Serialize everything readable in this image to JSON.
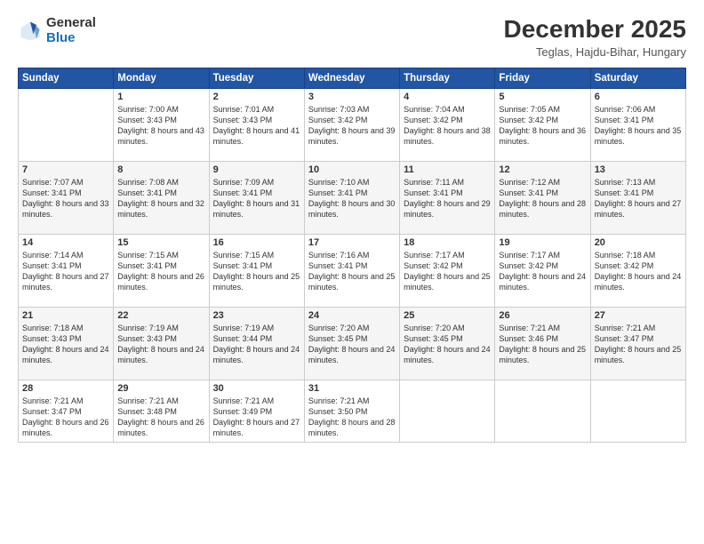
{
  "header": {
    "logo_general": "General",
    "logo_blue": "Blue",
    "title": "December 2025",
    "subtitle": "Teglas, Hajdu-Bihar, Hungary"
  },
  "weekdays": [
    "Sunday",
    "Monday",
    "Tuesday",
    "Wednesday",
    "Thursday",
    "Friday",
    "Saturday"
  ],
  "weeks": [
    [
      {
        "day": "",
        "sunrise": "",
        "sunset": "",
        "daylight": ""
      },
      {
        "day": "1",
        "sunrise": "Sunrise: 7:00 AM",
        "sunset": "Sunset: 3:43 PM",
        "daylight": "Daylight: 8 hours and 43 minutes."
      },
      {
        "day": "2",
        "sunrise": "Sunrise: 7:01 AM",
        "sunset": "Sunset: 3:43 PM",
        "daylight": "Daylight: 8 hours and 41 minutes."
      },
      {
        "day": "3",
        "sunrise": "Sunrise: 7:03 AM",
        "sunset": "Sunset: 3:42 PM",
        "daylight": "Daylight: 8 hours and 39 minutes."
      },
      {
        "day": "4",
        "sunrise": "Sunrise: 7:04 AM",
        "sunset": "Sunset: 3:42 PM",
        "daylight": "Daylight: 8 hours and 38 minutes."
      },
      {
        "day": "5",
        "sunrise": "Sunrise: 7:05 AM",
        "sunset": "Sunset: 3:42 PM",
        "daylight": "Daylight: 8 hours and 36 minutes."
      },
      {
        "day": "6",
        "sunrise": "Sunrise: 7:06 AM",
        "sunset": "Sunset: 3:41 PM",
        "daylight": "Daylight: 8 hours and 35 minutes."
      }
    ],
    [
      {
        "day": "7",
        "sunrise": "Sunrise: 7:07 AM",
        "sunset": "Sunset: 3:41 PM",
        "daylight": "Daylight: 8 hours and 33 minutes."
      },
      {
        "day": "8",
        "sunrise": "Sunrise: 7:08 AM",
        "sunset": "Sunset: 3:41 PM",
        "daylight": "Daylight: 8 hours and 32 minutes."
      },
      {
        "day": "9",
        "sunrise": "Sunrise: 7:09 AM",
        "sunset": "Sunset: 3:41 PM",
        "daylight": "Daylight: 8 hours and 31 minutes."
      },
      {
        "day": "10",
        "sunrise": "Sunrise: 7:10 AM",
        "sunset": "Sunset: 3:41 PM",
        "daylight": "Daylight: 8 hours and 30 minutes."
      },
      {
        "day": "11",
        "sunrise": "Sunrise: 7:11 AM",
        "sunset": "Sunset: 3:41 PM",
        "daylight": "Daylight: 8 hours and 29 minutes."
      },
      {
        "day": "12",
        "sunrise": "Sunrise: 7:12 AM",
        "sunset": "Sunset: 3:41 PM",
        "daylight": "Daylight: 8 hours and 28 minutes."
      },
      {
        "day": "13",
        "sunrise": "Sunrise: 7:13 AM",
        "sunset": "Sunset: 3:41 PM",
        "daylight": "Daylight: 8 hours and 27 minutes."
      }
    ],
    [
      {
        "day": "14",
        "sunrise": "Sunrise: 7:14 AM",
        "sunset": "Sunset: 3:41 PM",
        "daylight": "Daylight: 8 hours and 27 minutes."
      },
      {
        "day": "15",
        "sunrise": "Sunrise: 7:15 AM",
        "sunset": "Sunset: 3:41 PM",
        "daylight": "Daylight: 8 hours and 26 minutes."
      },
      {
        "day": "16",
        "sunrise": "Sunrise: 7:15 AM",
        "sunset": "Sunset: 3:41 PM",
        "daylight": "Daylight: 8 hours and 25 minutes."
      },
      {
        "day": "17",
        "sunrise": "Sunrise: 7:16 AM",
        "sunset": "Sunset: 3:41 PM",
        "daylight": "Daylight: 8 hours and 25 minutes."
      },
      {
        "day": "18",
        "sunrise": "Sunrise: 7:17 AM",
        "sunset": "Sunset: 3:42 PM",
        "daylight": "Daylight: 8 hours and 25 minutes."
      },
      {
        "day": "19",
        "sunrise": "Sunrise: 7:17 AM",
        "sunset": "Sunset: 3:42 PM",
        "daylight": "Daylight: 8 hours and 24 minutes."
      },
      {
        "day": "20",
        "sunrise": "Sunrise: 7:18 AM",
        "sunset": "Sunset: 3:42 PM",
        "daylight": "Daylight: 8 hours and 24 minutes."
      }
    ],
    [
      {
        "day": "21",
        "sunrise": "Sunrise: 7:18 AM",
        "sunset": "Sunset: 3:43 PM",
        "daylight": "Daylight: 8 hours and 24 minutes."
      },
      {
        "day": "22",
        "sunrise": "Sunrise: 7:19 AM",
        "sunset": "Sunset: 3:43 PM",
        "daylight": "Daylight: 8 hours and 24 minutes."
      },
      {
        "day": "23",
        "sunrise": "Sunrise: 7:19 AM",
        "sunset": "Sunset: 3:44 PM",
        "daylight": "Daylight: 8 hours and 24 minutes."
      },
      {
        "day": "24",
        "sunrise": "Sunrise: 7:20 AM",
        "sunset": "Sunset: 3:45 PM",
        "daylight": "Daylight: 8 hours and 24 minutes."
      },
      {
        "day": "25",
        "sunrise": "Sunrise: 7:20 AM",
        "sunset": "Sunset: 3:45 PM",
        "daylight": "Daylight: 8 hours and 24 minutes."
      },
      {
        "day": "26",
        "sunrise": "Sunrise: 7:21 AM",
        "sunset": "Sunset: 3:46 PM",
        "daylight": "Daylight: 8 hours and 25 minutes."
      },
      {
        "day": "27",
        "sunrise": "Sunrise: 7:21 AM",
        "sunset": "Sunset: 3:47 PM",
        "daylight": "Daylight: 8 hours and 25 minutes."
      }
    ],
    [
      {
        "day": "28",
        "sunrise": "Sunrise: 7:21 AM",
        "sunset": "Sunset: 3:47 PM",
        "daylight": "Daylight: 8 hours and 26 minutes."
      },
      {
        "day": "29",
        "sunrise": "Sunrise: 7:21 AM",
        "sunset": "Sunset: 3:48 PM",
        "daylight": "Daylight: 8 hours and 26 minutes."
      },
      {
        "day": "30",
        "sunrise": "Sunrise: 7:21 AM",
        "sunset": "Sunset: 3:49 PM",
        "daylight": "Daylight: 8 hours and 27 minutes."
      },
      {
        "day": "31",
        "sunrise": "Sunrise: 7:21 AM",
        "sunset": "Sunset: 3:50 PM",
        "daylight": "Daylight: 8 hours and 28 minutes."
      },
      {
        "day": "",
        "sunrise": "",
        "sunset": "",
        "daylight": ""
      },
      {
        "day": "",
        "sunrise": "",
        "sunset": "",
        "daylight": ""
      },
      {
        "day": "",
        "sunrise": "",
        "sunset": "",
        "daylight": ""
      }
    ]
  ]
}
